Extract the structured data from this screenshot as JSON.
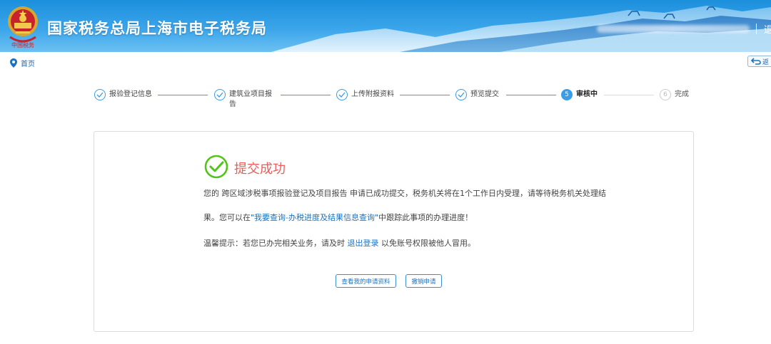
{
  "header": {
    "title": "国家税务总局上海市电子税务局",
    "emblem_text": "中国税务",
    "right_link": "退"
  },
  "breadcrumb": {
    "home": "首页"
  },
  "back_button": {
    "label": "返"
  },
  "steps": [
    {
      "num": "1",
      "label": "报验登记信息",
      "state": "done"
    },
    {
      "num": "2",
      "label": "建筑业项目报告",
      "state": "done"
    },
    {
      "num": "3",
      "label": "上传附报资料",
      "state": "done"
    },
    {
      "num": "4",
      "label": "预览提交",
      "state": "done"
    },
    {
      "num": "5",
      "label": "审核中",
      "state": "active"
    },
    {
      "num": "6",
      "label": "完成",
      "state": "todo"
    }
  ],
  "result": {
    "title": "提交成功",
    "line1": "您的 跨区域涉税事项报验登记及项目报告 申请已成功提交，税务机关将在1个工作日内受理，请等待税务机关处理结",
    "line2_prefix": "果。您可以在",
    "line2_link": "\"我要查询-办税进度及结果信息查询\"",
    "line2_suffix": "中跟踪此事项的办理进度！",
    "tip_prefix": "温馨提示：若您已办完相关业务，请及时 ",
    "tip_link": "退出登录",
    "tip_suffix": " 以免账号权限被他人冒用。"
  },
  "buttons": {
    "view": "查看我的申请资料",
    "revoke": "撤销申请"
  },
  "colors": {
    "accent": "#3a9de6",
    "success_green": "#52c41a",
    "success_title": "#ef5b5b",
    "link": "#1a72c4"
  }
}
